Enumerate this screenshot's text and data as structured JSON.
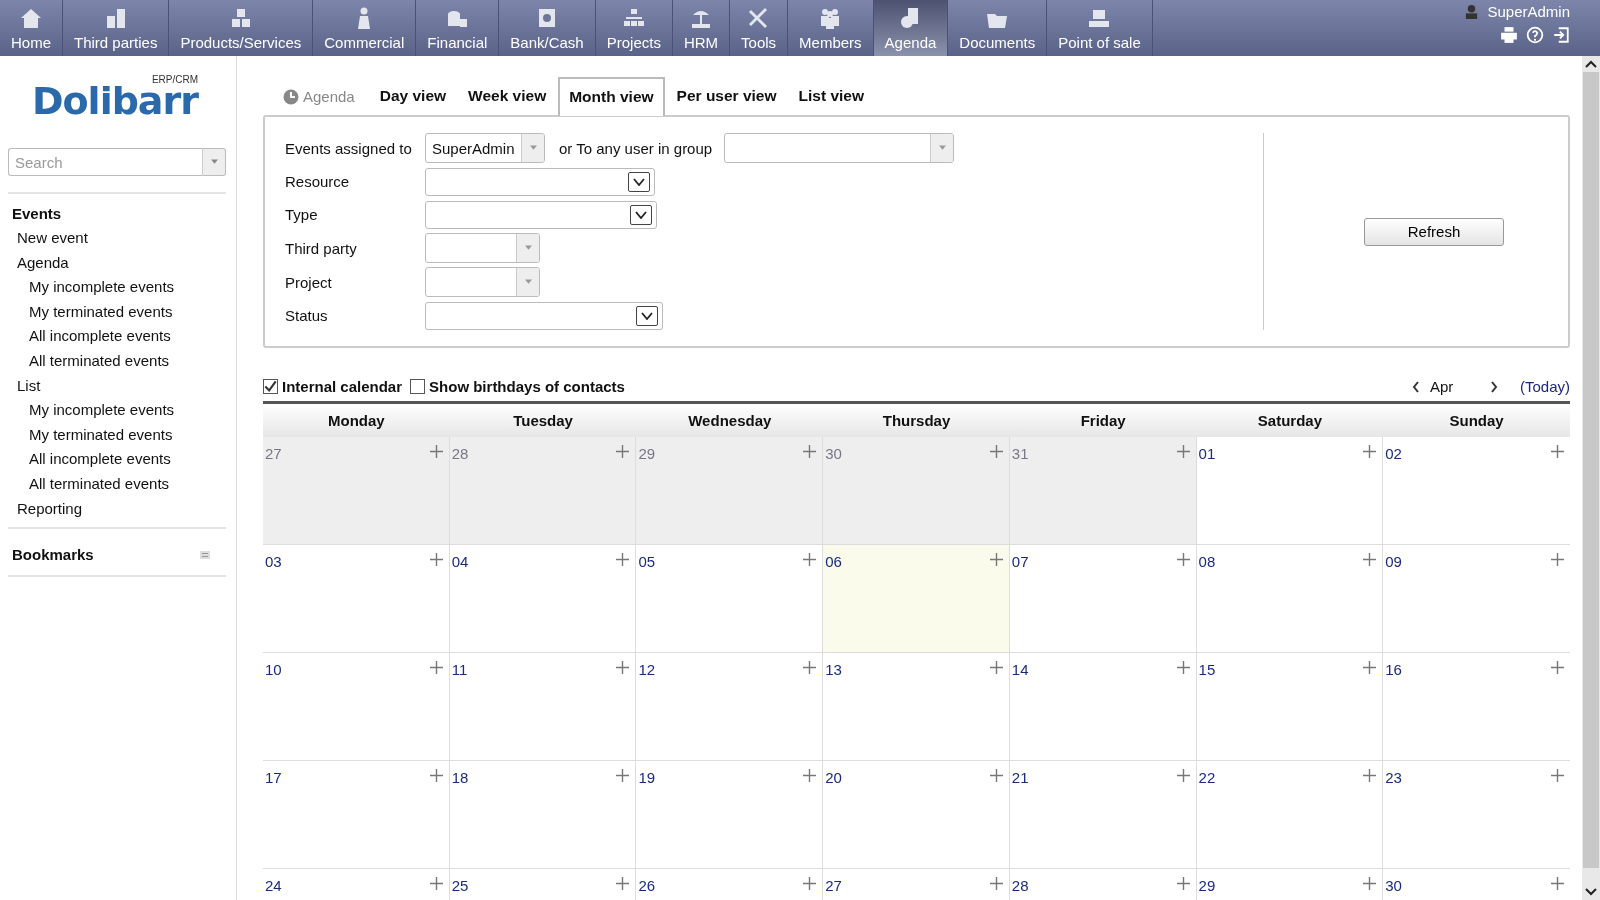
{
  "top_menu": [
    {
      "label": "Home",
      "selected": false
    },
    {
      "label": "Third parties",
      "selected": false
    },
    {
      "label": "Products/Services",
      "selected": false
    },
    {
      "label": "Commercial",
      "selected": false
    },
    {
      "label": "Financial",
      "selected": false
    },
    {
      "label": "Bank/Cash",
      "selected": false
    },
    {
      "label": "Projects",
      "selected": false
    },
    {
      "label": "HRM",
      "selected": false
    },
    {
      "label": "Tools",
      "selected": false
    },
    {
      "label": "Members",
      "selected": false
    },
    {
      "label": "Agenda",
      "selected": true
    },
    {
      "label": "Documents",
      "selected": false
    },
    {
      "label": "Point of sale",
      "selected": false
    }
  ],
  "user": {
    "name": "SuperAdmin"
  },
  "logo": {
    "name": "Dolibarr",
    "tag": "ERP/CRM"
  },
  "search": {
    "placeholder": "Search"
  },
  "sidebar": {
    "title": "Events",
    "items": [
      {
        "label": "New event"
      },
      {
        "label": "Agenda",
        "children": [
          {
            "label": "My incomplete events"
          },
          {
            "label": "My terminated events"
          },
          {
            "label": "All incomplete events"
          },
          {
            "label": "All terminated events"
          }
        ]
      },
      {
        "label": "List",
        "children": [
          {
            "label": "My incomplete events"
          },
          {
            "label": "My terminated events"
          },
          {
            "label": "All incomplete events"
          },
          {
            "label": "All terminated events"
          }
        ]
      },
      {
        "label": "Reporting"
      }
    ],
    "bookmarks": "Bookmarks"
  },
  "tabs": [
    {
      "label": "Agenda",
      "kind": "title",
      "selected": false
    },
    {
      "label": "Day view",
      "kind": "tab",
      "selected": false
    },
    {
      "label": "Week view",
      "kind": "tab",
      "selected": false
    },
    {
      "label": "Month view",
      "kind": "tab",
      "selected": true
    },
    {
      "label": "Per user view",
      "kind": "tab",
      "selected": false
    },
    {
      "label": "List view",
      "kind": "tab",
      "selected": false
    }
  ],
  "filters": {
    "assigned_label": "Events assigned to",
    "assigned_value": "SuperAdmin",
    "group_label": "or To any user in group",
    "rows": [
      {
        "label": "Resource",
        "kind": "select"
      },
      {
        "label": "Type",
        "kind": "select"
      },
      {
        "label": "Third party",
        "kind": "combo"
      },
      {
        "label": "Project",
        "kind": "combo"
      },
      {
        "label": "Status",
        "kind": "select"
      }
    ],
    "refresh": "Refresh"
  },
  "options": [
    {
      "label": "Internal calendar",
      "checked": true
    },
    {
      "label": "Show birthdays of contacts",
      "checked": false
    }
  ],
  "nav": {
    "month": "Apr",
    "today": "(Today)"
  },
  "calendar": {
    "days": [
      "Monday",
      "Tuesday",
      "Wednesday",
      "Thursday",
      "Friday",
      "Saturday",
      "Sunday"
    ],
    "weeks": [
      [
        {
          "day": "27",
          "other_month": true,
          "today": false
        },
        {
          "day": "28",
          "other_month": true,
          "today": false
        },
        {
          "day": "29",
          "other_month": true,
          "today": false
        },
        {
          "day": "30",
          "other_month": true,
          "today": false
        },
        {
          "day": "31",
          "other_month": true,
          "today": false
        },
        {
          "day": "01",
          "other_month": false,
          "today": false
        },
        {
          "day": "02",
          "other_month": false,
          "today": false
        }
      ],
      [
        {
          "day": "03",
          "other_month": false,
          "today": false
        },
        {
          "day": "04",
          "other_month": false,
          "today": false
        },
        {
          "day": "05",
          "other_month": false,
          "today": false
        },
        {
          "day": "06",
          "other_month": false,
          "today": true
        },
        {
          "day": "07",
          "other_month": false,
          "today": false
        },
        {
          "day": "08",
          "other_month": false,
          "today": false
        },
        {
          "day": "09",
          "other_month": false,
          "today": false
        }
      ],
      [
        {
          "day": "10",
          "other_month": false,
          "today": false
        },
        {
          "day": "11",
          "other_month": false,
          "today": false
        },
        {
          "day": "12",
          "other_month": false,
          "today": false
        },
        {
          "day": "13",
          "other_month": false,
          "today": false
        },
        {
          "day": "14",
          "other_month": false,
          "today": false
        },
        {
          "day": "15",
          "other_month": false,
          "today": false
        },
        {
          "day": "16",
          "other_month": false,
          "today": false
        }
      ],
      [
        {
          "day": "17",
          "other_month": false,
          "today": false
        },
        {
          "day": "18",
          "other_month": false,
          "today": false
        },
        {
          "day": "19",
          "other_month": false,
          "today": false
        },
        {
          "day": "20",
          "other_month": false,
          "today": false
        },
        {
          "day": "21",
          "other_month": false,
          "today": false
        },
        {
          "day": "22",
          "other_month": false,
          "today": false
        },
        {
          "day": "23",
          "other_month": false,
          "today": false
        }
      ],
      [
        {
          "day": "24",
          "other_month": false,
          "today": false
        },
        {
          "day": "25",
          "other_month": false,
          "today": false
        },
        {
          "day": "26",
          "other_month": false,
          "today": false
        },
        {
          "day": "27",
          "other_month": false,
          "today": false
        },
        {
          "day": "28",
          "other_month": false,
          "today": false
        },
        {
          "day": "29",
          "other_month": false,
          "today": false
        },
        {
          "day": "30",
          "other_month": false,
          "today": false
        }
      ]
    ]
  }
}
